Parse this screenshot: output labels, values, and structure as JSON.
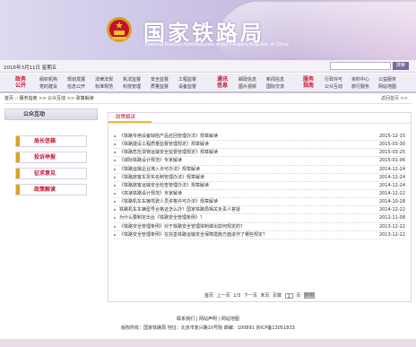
{
  "header": {
    "title": "国家铁路局",
    "subtitle": "National Railway Administration of the People's Republic of China"
  },
  "datebar": {
    "date": "2016年3月11日 星期五",
    "search_placeholder": "",
    "search_button": "搜索"
  },
  "nav": {
    "groups": [
      {
        "category": "政务\n公开",
        "cols": [
          [
            "组织机构",
            "党的建设"
          ],
          [
            "规划发展",
            "信息公开"
          ],
          [
            "法律法规",
            "标准规范"
          ],
          [
            "执法监督",
            "科技管理"
          ],
          [
            "安全监督",
            "质量监督"
          ],
          [
            "工程监督",
            "设备监督"
          ]
        ]
      },
      {
        "category": "通讯\n信息",
        "cols": [
          [
            "邮政信息",
            "图片视频"
          ],
          [
            "新闻信息",
            "国际交流"
          ]
        ]
      },
      {
        "category": "服务\n指南",
        "cols": [
          [
            "行政许可",
            "公众互动"
          ],
          [
            "资料中心",
            "旅行服务"
          ],
          [
            "公益服务",
            "网站地图"
          ]
        ]
      }
    ]
  },
  "breadcrumb": {
    "text": "首页 :: 服务指南 >> 公众互动 >> 政策解读",
    "right": "返回首页 >>"
  },
  "sidebar": {
    "heading": "公众互动",
    "items": [
      "局长信箱",
      "投诉举报",
      "征求意见",
      "政策解读"
    ]
  },
  "main": {
    "tab": "政策解读",
    "rows": [
      {
        "title": "《铁路专用设备缺陷产品召回管理办法》规章解读",
        "date": "2015-12-15"
      },
      {
        "title": "《铁路建设工程质量监督管理规定》规章解读",
        "date": "2015-03-30"
      },
      {
        "title": "《铁路危险货物运输安全监督管理规定》规章解读",
        "date": "2015-03-25"
      },
      {
        "title": "《城际铁路设计规范》专家解读",
        "date": "2015-01-06"
      },
      {
        "title": "《铁路运输企业准入许可办法》规章解读",
        "date": "2014-12-24"
      },
      {
        "title": "《铁路旅客车票实名制管理办法》规章解读",
        "date": "2014-12-24"
      },
      {
        "title": "《铁路旅客运输安全检查管理办法》规章解读",
        "date": "2014-12-24"
      },
      {
        "title": "《高速铁路设计规范》专家解读",
        "date": "2014-12-22"
      },
      {
        "title": "《铁路机车车辆驾驶人员资格许可办法》规章解读",
        "date": "2014-10-28"
      },
      {
        "title": "铁路机车车辆型号合格证怎么办？国家铁路局相关负责人答疑",
        "date": "2014-12-22"
      },
      {
        "title": "为什么要制定出台《铁路安全管理条例》？",
        "date": "2012-11-08"
      },
      {
        "title": "《铁路安全管理条例》对于铁路安全管理体制做出如何规定的？",
        "date": "2013-12-22"
      },
      {
        "title": "《铁路安全管理条例》在完善铁路运输安全保障措施方面进作了哪些规定？",
        "date": "2013-12-22"
      }
    ],
    "pager": {
      "first": "首页",
      "prev": "上一页",
      "info": "1/3",
      "next": "下一页",
      "last": "末页",
      "goto": "页数",
      "page_value": "1",
      "unit": "页",
      "go": "转到"
    }
  },
  "footer": {
    "links": "联系我们 | 网站声明 | 网站地图",
    "copyright": "版权所有：国家铁路局   地址：北京市复兴路10号院   邮编：100891   京ICP备13051833"
  }
}
